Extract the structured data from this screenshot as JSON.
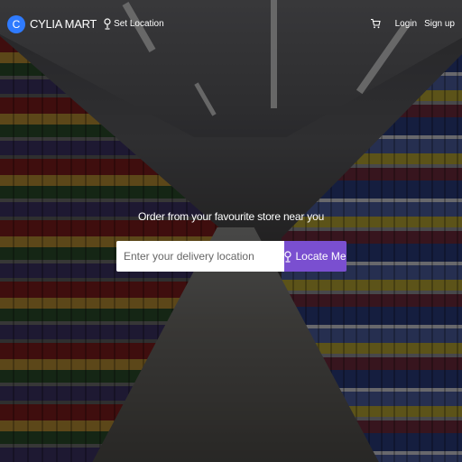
{
  "header": {
    "logo_letter": "C",
    "brand": "CYLIA MART",
    "set_location": "Set Location",
    "login": "Login",
    "signup": "Sign up"
  },
  "hero": {
    "title": "Order from your favourite store near you",
    "search_placeholder": "Enter your delivery location",
    "locate_button": "Locate Me"
  },
  "colors": {
    "logo": "#2f7bff",
    "accent_button": "#7a4fd0"
  },
  "icons": [
    "location-pin-icon",
    "cart-icon"
  ]
}
